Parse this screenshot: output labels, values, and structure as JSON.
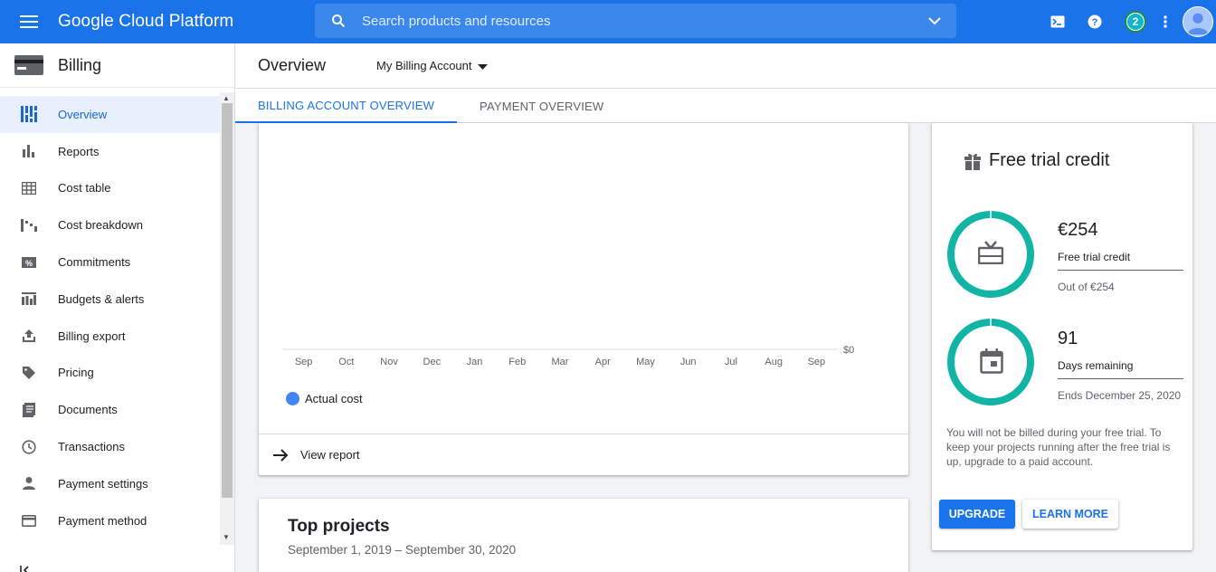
{
  "topbar": {
    "brand": "Google Cloud Platform",
    "search_placeholder": "Search products and resources",
    "notification_count": "2",
    "icons": [
      "menu-icon",
      "search-icon",
      "chevron-down-icon",
      "cloud-shell-icon",
      "help-icon",
      "more-vert-icon",
      "account-avatar"
    ]
  },
  "sidebar": {
    "title": "Billing",
    "items": [
      {
        "label": "Overview",
        "icon": "dashboard-icon",
        "active": true
      },
      {
        "label": "Reports",
        "icon": "bar-chart-icon"
      },
      {
        "label": "Cost table",
        "icon": "table-icon"
      },
      {
        "label": "Cost breakdown",
        "icon": "waterfall-icon"
      },
      {
        "label": "Commitments",
        "icon": "percent-icon"
      },
      {
        "label": "Budgets & alerts",
        "icon": "budget-icon"
      },
      {
        "label": "Billing export",
        "icon": "upload-icon"
      },
      {
        "label": "Pricing",
        "icon": "tag-icon"
      },
      {
        "label": "Documents",
        "icon": "document-icon"
      },
      {
        "label": "Transactions",
        "icon": "clock-icon"
      },
      {
        "label": "Payment settings",
        "icon": "person-icon"
      },
      {
        "label": "Payment method",
        "icon": "credit-card-icon"
      }
    ]
  },
  "header": {
    "title": "Overview",
    "account": "My Billing Account"
  },
  "tabs": [
    {
      "label": "BILLING ACCOUNT OVERVIEW",
      "active": true
    },
    {
      "label": "PAYMENT OVERVIEW",
      "active": false
    }
  ],
  "chart_data": {
    "type": "bar",
    "categories": [
      "Sep",
      "Oct",
      "Nov",
      "Dec",
      "Jan",
      "Feb",
      "Mar",
      "Apr",
      "May",
      "Jun",
      "Jul",
      "Aug",
      "Sep"
    ],
    "series": [
      {
        "name": "Actual cost",
        "values": [
          0,
          0,
          0,
          0,
          0,
          0,
          0,
          0,
          0,
          0,
          0,
          0,
          0
        ]
      }
    ],
    "y_tick_labels": [
      "$0"
    ],
    "legend_position": "bottom-left",
    "colors": {
      "actual_cost": "#4285f4"
    }
  },
  "chart_card": {
    "view_report": "View report"
  },
  "projects": {
    "title": "Top projects",
    "date_range": "September 1, 2019 – September 30, 2020"
  },
  "trial": {
    "title": "Free trial credit",
    "credit_amount": "€254",
    "credit_label": "Free trial credit",
    "credit_sub": "Out of €254",
    "credit_fraction": 1.0,
    "days": "91",
    "days_label": "Days remaining",
    "days_sub": "Ends December 25, 2020",
    "days_fraction": 1.0,
    "note": "You will not be billed during your free trial. To keep your projects running after the free trial is up, upgrade to a paid account.",
    "upgrade": "UPGRADE",
    "learn_more": "LEARN MORE",
    "ring_color": "#12b5a5"
  }
}
